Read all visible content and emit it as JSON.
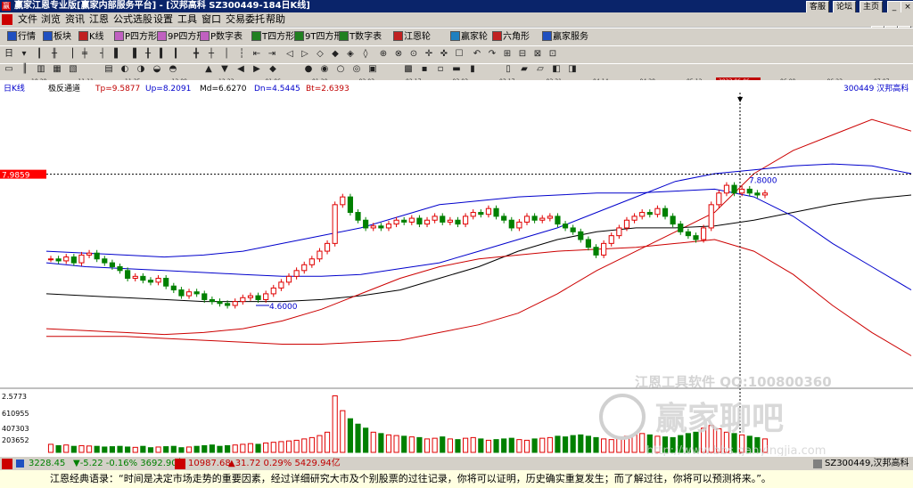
{
  "titlebar": {
    "title": "赢家江恩专业版[赢家内部服务平台] - [汉邦高科  SZ300449-184日K线]",
    "icon_text": "赢",
    "buttons": [
      "客服",
      "论坛",
      "主页"
    ]
  },
  "menu": [
    "文件",
    "浏览",
    "资讯",
    "江恩",
    "公式选股",
    "设置",
    "工具",
    "窗口",
    "交易委托",
    "帮助"
  ],
  "toolbar1": [
    "行情",
    "板块",
    "K线",
    "P四方形",
    "9P四方形",
    "P数字表",
    "T四方形",
    "9T四方形",
    "T数字表",
    "江恩轮",
    "赢家轮",
    "六角形",
    "赢家服务"
  ],
  "toolbar1_colors": [
    "#2050c0",
    "#2050c0",
    "#c02020",
    "#c060c0",
    "#c060c0",
    "#c060c0",
    "#208020",
    "#208020",
    "#208020",
    "#c02020",
    "#2080c0",
    "#c02020",
    "#2050c0"
  ],
  "dates": [
    "10-28",
    "11-11",
    "11-25",
    "12-09",
    "12-23",
    "01-06",
    "01-20",
    "02-03",
    "02-17",
    "03-03",
    "03-17",
    "03-31",
    "04-14",
    "04-28",
    "05-12",
    "05-26",
    "06-09",
    "06-23",
    "07-07",
    "07-21"
  ],
  "chart": {
    "period_label": "日K线",
    "indicator": {
      "name": "极反通道",
      "tp": "Tp=9.5877",
      "up": "Up=8.2091",
      "md": "Md=6.6270",
      "dn": "Dn=4.5445",
      "bt": "Bt=2.6393"
    },
    "code_name": "300449  汉邦高科",
    "cursor_date": "2023-06-06",
    "cursor_price": "7.9859",
    "high_label": "7.8000",
    "low_label": "4.6000",
    "volume_labels": [
      "2.5773",
      "610955",
      "407303",
      "203652"
    ],
    "watermark": [
      "江恩工具软件  QQ:100800360",
      "赢家聊吧",
      "http://www.bbs.ganyingjia.com"
    ],
    "colors": {
      "up": "#e00000",
      "down": "#008000",
      "mid": "#000000",
      "inner_band": "#0000cc",
      "outer_band": "#cc0000",
      "cursor_tag": "#ff0000"
    }
  },
  "chart_data": {
    "type": "candlestick",
    "title": "汉邦高科 SZ300449 日K线",
    "x_ticks": [
      "10-28",
      "11-11",
      "11-25",
      "12-09",
      "12-23",
      "01-06",
      "01-20",
      "02-03",
      "02-17",
      "03-03",
      "03-17",
      "03-31",
      "04-14",
      "04-28",
      "05-12",
      "05-26",
      "06-09",
      "06-23",
      "07-07",
      "07-21"
    ],
    "tp_series": [
      3.8,
      3.8,
      3.8,
      3.75,
      3.7,
      3.65,
      3.6,
      3.6,
      3.65,
      3.7,
      3.9,
      4.1,
      4.4,
      4.9,
      5.5,
      6.0,
      6.5,
      7.0,
      8.0,
      8.6,
      9.0,
      9.4,
      9.1
    ],
    "up_series": [
      5.7,
      5.6,
      5.55,
      5.5,
      5.45,
      5.4,
      5.35,
      5.35,
      5.4,
      5.55,
      5.7,
      6.0,
      6.3,
      6.6,
      7.0,
      7.4,
      7.8,
      8.0,
      8.1,
      8.2,
      8.25,
      8.2,
      8.0
    ],
    "md_series": [
      4.9,
      4.85,
      4.8,
      4.75,
      4.7,
      4.7,
      4.7,
      4.75,
      4.85,
      5.0,
      5.3,
      5.6,
      6.0,
      6.3,
      6.5,
      6.6,
      6.6,
      6.65,
      6.8,
      7.0,
      7.2,
      7.35,
      7.45
    ],
    "dn_series": [
      6.0,
      5.95,
      5.9,
      5.85,
      5.9,
      6.0,
      6.2,
      6.4,
      6.6,
      6.9,
      7.2,
      7.3,
      7.4,
      7.45,
      7.5,
      7.5,
      7.55,
      7.6,
      7.4,
      6.9,
      6.2,
      5.6,
      5.0
    ],
    "bt_series": [
      4.0,
      3.95,
      3.9,
      3.85,
      3.9,
      4.0,
      4.2,
      4.5,
      4.9,
      5.3,
      5.6,
      5.8,
      5.9,
      6.0,
      6.05,
      6.1,
      6.2,
      6.3,
      6.0,
      5.4,
      4.6,
      3.9,
      3.3
    ],
    "close": [
      5.8,
      5.75,
      5.85,
      5.7,
      5.9,
      5.95,
      5.8,
      5.7,
      5.6,
      5.5,
      5.3,
      5.35,
      5.25,
      5.2,
      5.3,
      5.1,
      5.0,
      4.85,
      4.95,
      4.9,
      4.75,
      4.7,
      4.65,
      4.6,
      4.7,
      4.8,
      4.85,
      4.75,
      4.9,
      5.05,
      5.2,
      5.35,
      5.5,
      5.65,
      5.8,
      6.0,
      6.2,
      7.2,
      7.4,
      7.0,
      6.8,
      6.6,
      6.65,
      6.6,
      6.7,
      6.8,
      6.75,
      6.85,
      6.7,
      6.8,
      6.9,
      6.75,
      6.8,
      6.7,
      6.9,
      7.0,
      6.95,
      7.1,
      6.9,
      6.8,
      6.6,
      6.75,
      6.9,
      6.8,
      6.85,
      6.9,
      6.7,
      6.6,
      6.5,
      6.3,
      6.1,
      5.9,
      6.2,
      6.4,
      6.6,
      6.8,
      6.9,
      7.0,
      6.95,
      7.1,
      6.9,
      6.7,
      6.5,
      6.4,
      6.3,
      6.6,
      7.2,
      7.5,
      7.7,
      7.5,
      7.6,
      7.5,
      7.45,
      7.5
    ],
    "volume": [
      1.2,
      1.0,
      1.1,
      0.9,
      1.0,
      0.95,
      0.9,
      0.8,
      0.85,
      0.9,
      0.8,
      0.75,
      0.9,
      0.7,
      0.8,
      0.85,
      0.9,
      0.7,
      0.8,
      0.9,
      1.0,
      1.1,
      0.9,
      1.0,
      1.1,
      1.2,
      1.3,
      1.2,
      1.4,
      1.5,
      1.6,
      1.7,
      1.8,
      2.0,
      2.2,
      2.5,
      3.0,
      8.4,
      6.2,
      5.0,
      4.2,
      3.6,
      3.0,
      2.8,
      2.6,
      2.5,
      2.4,
      2.3,
      2.2,
      2.0,
      2.1,
      2.3,
      2.0,
      1.9,
      2.1,
      2.2,
      2.0,
      1.8,
      1.9,
      2.0,
      2.1,
      1.9,
      1.8,
      2.0,
      2.1,
      2.2,
      2.4,
      2.3,
      2.5,
      2.6,
      2.4,
      2.2,
      2.0,
      1.9,
      2.2,
      2.4,
      2.6,
      2.8,
      2.6,
      2.4,
      2.3,
      2.2,
      2.5,
      2.8,
      3.0,
      3.6,
      4.0,
      3.5,
      3.0,
      2.8,
      2.6,
      2.4,
      2.2,
      2.0
    ],
    "ylim": [
      2.6,
      10.0
    ],
    "legend": [
      "Tp",
      "Up",
      "Md",
      "Dn",
      "Bt"
    ]
  },
  "statusbar": {
    "sh": "3228.45",
    "sh_change": "▼-5.22 -0.16% 3692.90亿",
    "sz": "10987.68",
    "sz_change": "▲31.72 0.29% 5429.94亿",
    "right": "SZ300449,汉邦高科"
  },
  "quote": "江恩经典语录：“时间是决定市场走势的重要因素，经过详细研究大市及个别股票的过往记录，你将可以证明，历史确实重复发生；而了解过往，你将可以预测将来。”。"
}
